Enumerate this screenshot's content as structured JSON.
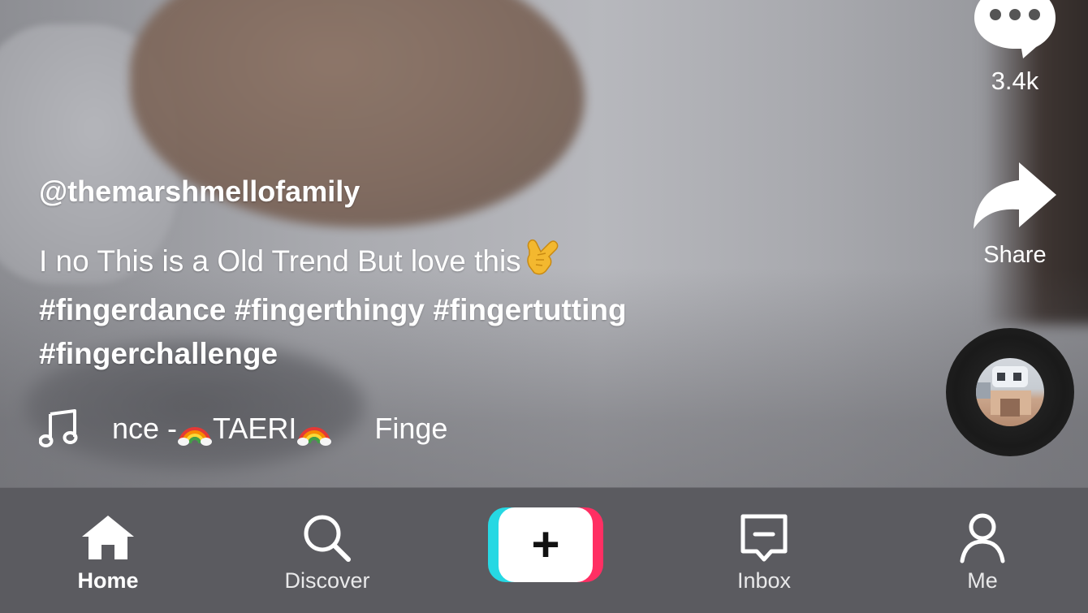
{
  "video": {
    "username": "@themarshmellofamily",
    "description_text": "I no This is a Old Trend But love this",
    "description_emoji": "🤙",
    "hashtags_line1": "#fingerdance #fingerthingy #fingertutting",
    "hashtags_line2": "#fingerchallenge",
    "music": {
      "prefix": "nce - ",
      "artist": "TAERI",
      "suffix": "Finge",
      "icon": "music-note-icon"
    }
  },
  "actions": {
    "comments_count": "3.4k",
    "share_label": "Share",
    "comment_icon": "comment-bubble-icon",
    "share_icon": "share-arrow-icon"
  },
  "nav": {
    "items": [
      {
        "label": "Home",
        "icon": "home-icon",
        "active": true
      },
      {
        "label": "Discover",
        "icon": "search-icon",
        "active": false
      },
      {
        "label": "",
        "icon": "create-plus-icon",
        "active": false
      },
      {
        "label": "Inbox",
        "icon": "inbox-icon",
        "active": false
      },
      {
        "label": "Me",
        "icon": "profile-icon",
        "active": false
      }
    ],
    "create_symbol": "+"
  },
  "colors": {
    "nav_bg": "#5b5b60",
    "create_cyan": "#26d8e3",
    "create_red": "#ff2f63",
    "text": "#ffffff"
  }
}
